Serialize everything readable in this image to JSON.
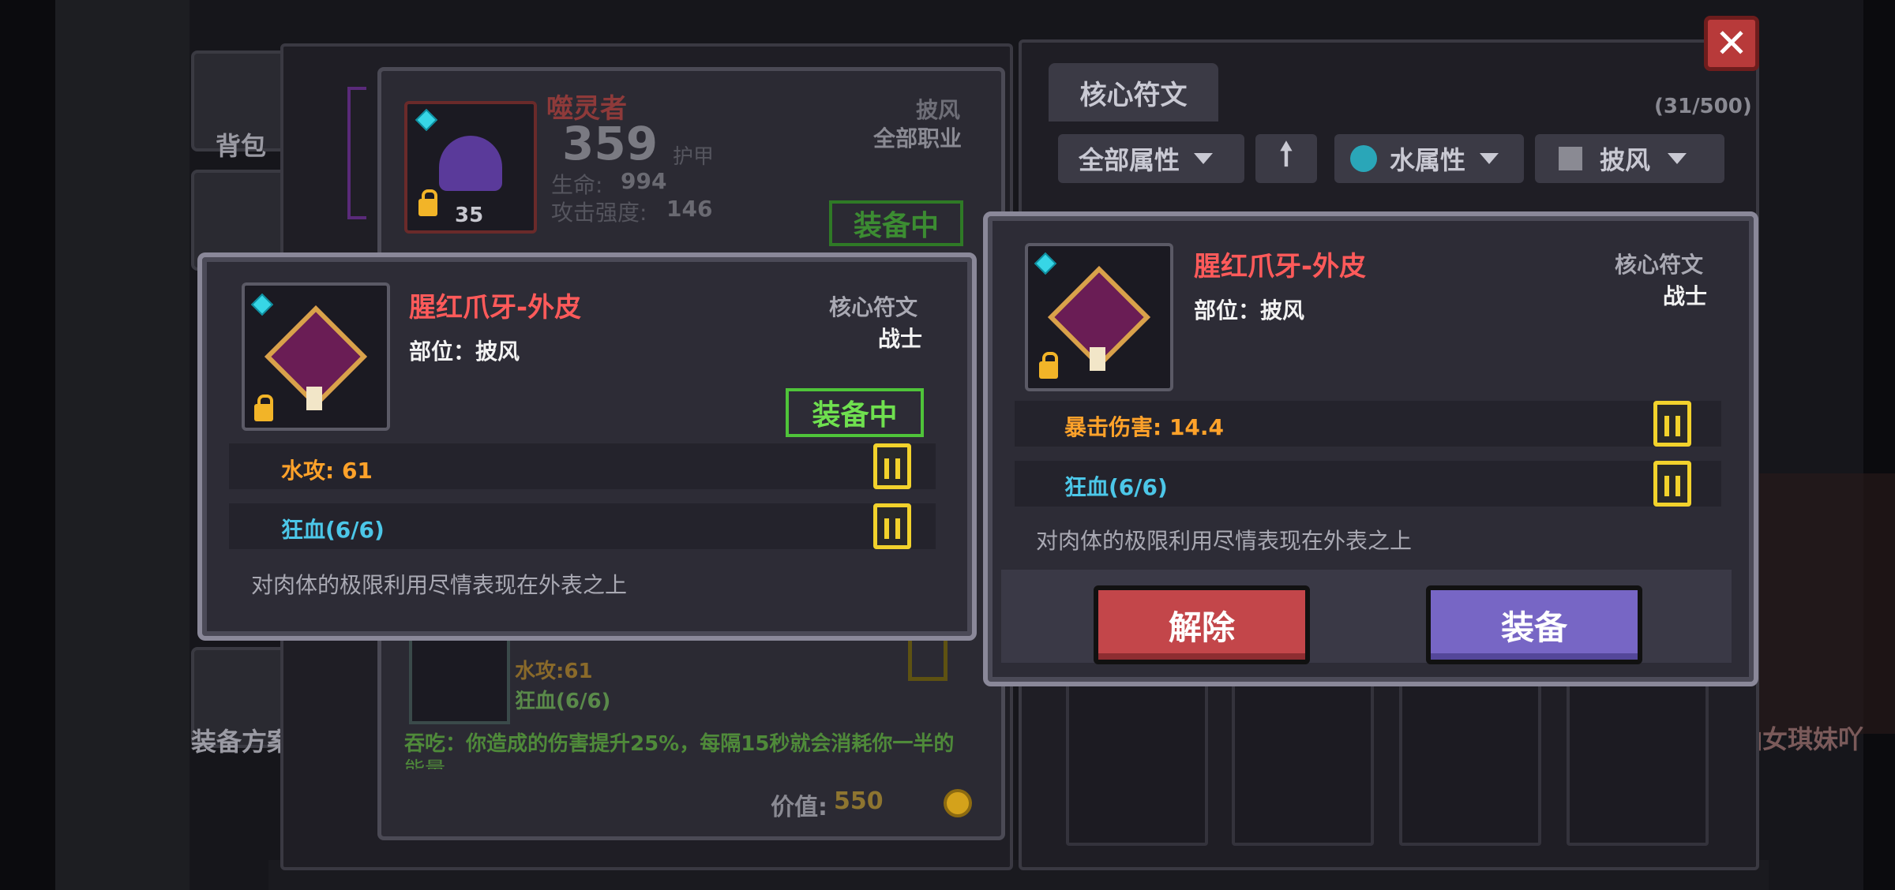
{
  "background_menu": {
    "backpack": "背包",
    "equip_plan": "装备方案",
    "right_npc": "仙女琪妹吖"
  },
  "equipped_panel": {
    "name": "噬灵者",
    "slot": "披风",
    "class": "全部职业",
    "power": "359",
    "power_unit": "护甲",
    "stat1_label": "生命:",
    "stat1_value": "994",
    "stat2_label": "攻击强度:",
    "stat2_value": "146",
    "level": "35",
    "equipped_tag": "装备中",
    "sub_stat1": "水攻:61",
    "sub_stat2": "狂血(6/6)",
    "desc": "吞吃：你造成的伤害提升25%，每隔15秒就会消耗你一半的",
    "desc2": "能量",
    "value_label": "价值:",
    "value": "550"
  },
  "rune_panel": {
    "tab": "核心符文",
    "count": "(31/500)",
    "filter_all": "全部属性",
    "filter_water": "水属性",
    "filter_slot": "披风"
  },
  "left_card": {
    "name": "腥红爪牙-外皮",
    "slot": "部位：披风",
    "type": "核心符文",
    "class": "战士",
    "equipped_tag": "装备中",
    "stat1": "水攻: 61",
    "stat2": "狂血(6/6)",
    "desc": "对肉体的极限利用尽情表现在外表之上"
  },
  "right_card": {
    "name": "腥红爪牙-外皮",
    "slot": "部位：披风",
    "type": "核心符文",
    "class": "战士",
    "stat1": "暴击伤害: 14.4",
    "stat2": "狂血(6/6)",
    "desc": "对肉体的极限利用尽情表现在外表之上",
    "btn_remove": "解除",
    "btn_equip": "装备"
  },
  "close_label": "✕"
}
